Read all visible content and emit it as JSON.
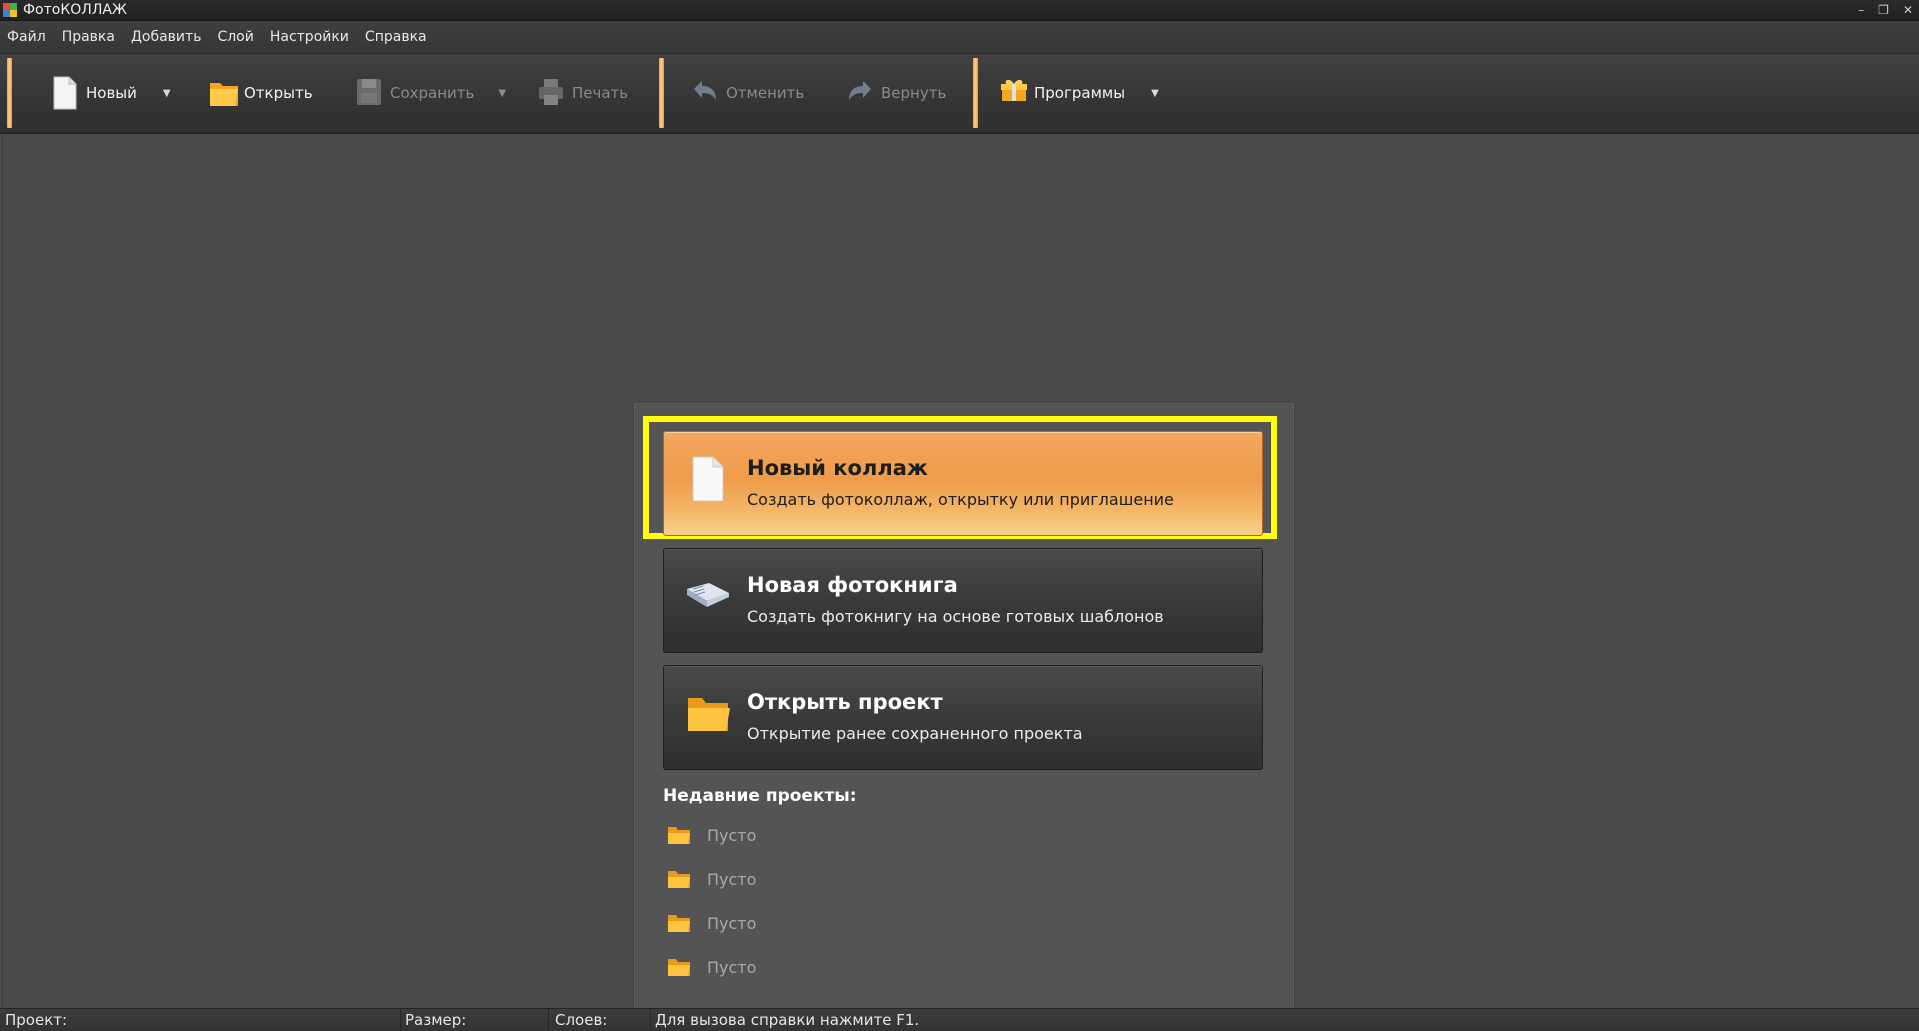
{
  "window": {
    "title": "ФотоКОЛЛАЖ"
  },
  "menu": [
    "Файл",
    "Правка",
    "Добавить",
    "Слой",
    "Настройки",
    "Справка"
  ],
  "toolbar": {
    "new_label": "Новый",
    "open_label": "Открыть",
    "save_label": "Сохранить",
    "print_label": "Печать",
    "undo_label": "Отменить",
    "redo_label": "Вернуть",
    "programs_label": "Программы"
  },
  "start": {
    "cards": [
      {
        "title": "Новый коллаж",
        "subtitle": "Создать фотоколлаж, открытку или приглашение"
      },
      {
        "title": "Новая фотокнига",
        "subtitle": "Создать фотокнигу на основе готовых шаблонов"
      },
      {
        "title": "Открыть проект",
        "subtitle": "Открытие ранее сохраненного проекта"
      }
    ],
    "recent_title": "Недавние проекты:",
    "recent": [
      "Пусто",
      "Пусто",
      "Пусто",
      "Пусто"
    ]
  },
  "status": {
    "project": "Проект:",
    "size": "Размер:",
    "layers": "Слоев:",
    "hint": "Для вызова справки нажмите F1."
  },
  "colors": {
    "accent": "#f0a24e",
    "highlight": "#ffff00",
    "background": "#4b4b4b"
  }
}
